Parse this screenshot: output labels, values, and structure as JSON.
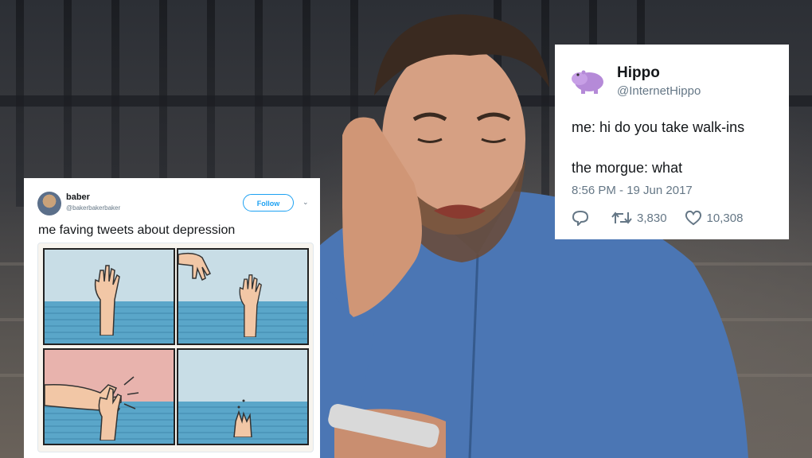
{
  "tweet_left": {
    "name": "baber",
    "handle": "@bakerbakerbaker",
    "follow_label": "Follow",
    "text": "me faving tweets about depression"
  },
  "tweet_right": {
    "name": "Hippo",
    "handle": "@InternetHippo",
    "line1": "me: hi do you take walk-ins",
    "line2": "the morgue: what",
    "timestamp": "8:56 PM - 19 Jun 2017",
    "retweets": "3,830",
    "likes": "10,308"
  },
  "icons": {
    "reply": "reply-icon",
    "retweet": "retweet-icon",
    "like": "heart-icon",
    "chevron": "chevron-down-icon"
  },
  "colors": {
    "twitter_blue": "#1da1f2",
    "hippo_purple": "#b58ad8",
    "shirt_blue": "#4b76b4"
  }
}
